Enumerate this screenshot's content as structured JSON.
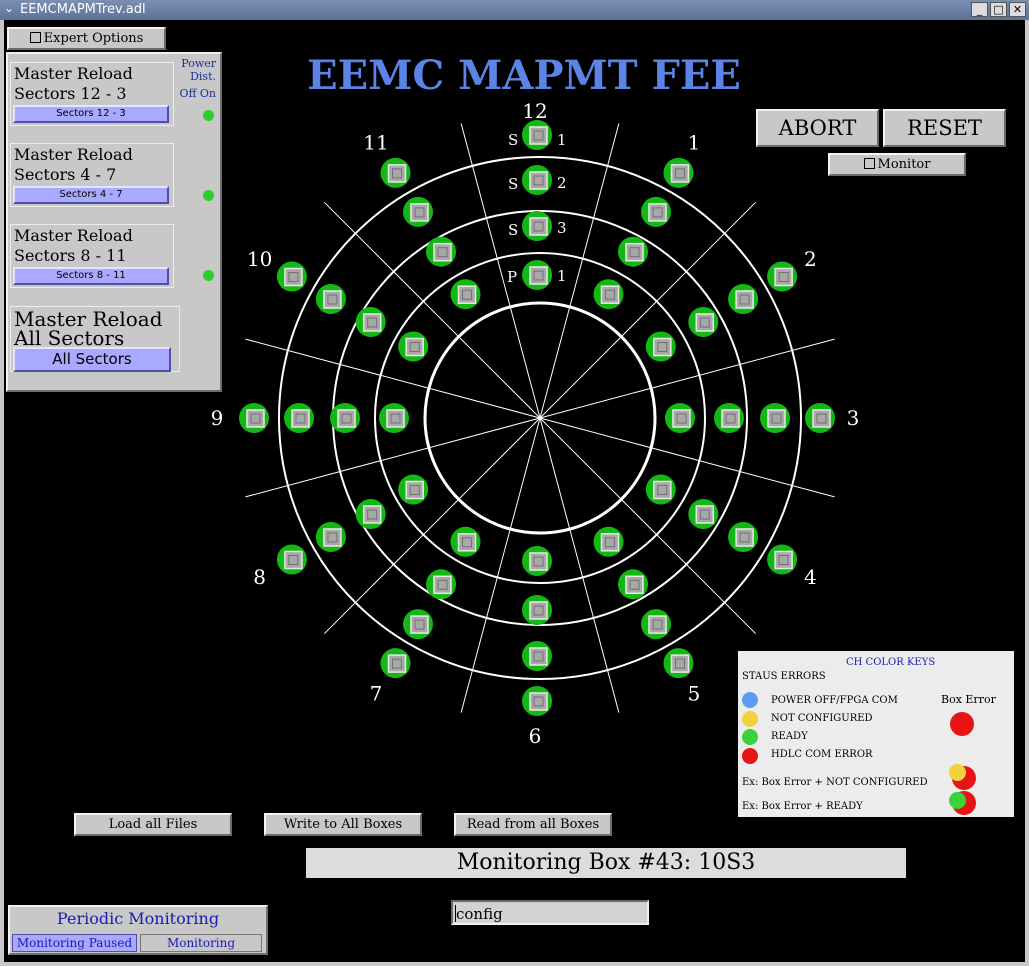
{
  "window": {
    "title": "EEMCMAPMTrev.adl",
    "menu_glyph": "⌄",
    "minimize": "_",
    "maximize": "□",
    "close": "✕"
  },
  "header": {
    "title": "EEMC MAPMT FEE"
  },
  "expert_options": {
    "label": "Expert Options"
  },
  "power": {
    "title": "Power",
    "line2": "Dist.",
    "off": "Off",
    "on": "On",
    "indicator_color": "#2ecc2e"
  },
  "master_reload": [
    {
      "title_line1": "Master Reload",
      "title_line2": "Sectors 12 - 3",
      "button": "Sectors 12 - 3"
    },
    {
      "title_line1": "Master Reload",
      "title_line2": "Sectors 4 - 7",
      "button": "Sectors 4 - 7"
    },
    {
      "title_line1": "Master Reload",
      "title_line2": "Sectors 8 - 11",
      "button": "Sectors 8 - 11"
    }
  ],
  "master_reload_all": {
    "title_line1": "Master Reload",
    "title_line2": "All Sectors",
    "button": "All Sectors"
  },
  "controls": {
    "abort": "ABORT",
    "reset": "RESET",
    "monitor": "Monitor"
  },
  "ring_labels": {
    "row1": "S",
    "row2": "S",
    "row3": "S",
    "row4": "P",
    "num1": "1",
    "num2": "2",
    "num3": "3",
    "num4": "1"
  },
  "sectors": [
    "12",
    "1",
    "2",
    "3",
    "4",
    "5",
    "6",
    "7",
    "8",
    "9",
    "10",
    "11"
  ],
  "box_color": "#14b814",
  "actions": {
    "load": "Load all Files",
    "write": "Write to All Boxes",
    "read": "Read from all Boxes"
  },
  "status": {
    "text": "Monitoring Box #43: 10S3"
  },
  "config": {
    "value": "config"
  },
  "periodic": {
    "title": "Periodic Monitoring",
    "paused": "Monitoring Paused",
    "monitoring": "Monitoring"
  },
  "color_keys": {
    "title": "CH COLOR KEYS",
    "subtitle": "STAUS ERRORS",
    "box_error": "Box Error",
    "items": [
      {
        "label": "POWER OFF/FPGA COM",
        "color": "#5b9cf0"
      },
      {
        "label": "NOT CONFIGURED",
        "color": "#f0d23c"
      },
      {
        "label": "READY",
        "color": "#3cd23c"
      },
      {
        "label": "HDLC COM ERROR",
        "color": "#e61414"
      }
    ],
    "ex1": "Ex: Box Error + NOT CONFIGURED",
    "ex2": "Ex: Box Error + READY",
    "error_color": "#e61414"
  }
}
